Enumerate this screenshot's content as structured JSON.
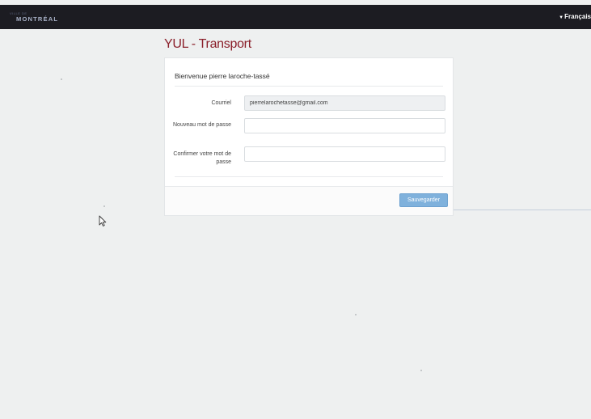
{
  "header": {
    "logo_small": "VILLE DE",
    "logo_text": "MONTRÉAL",
    "language_toggle": "Français"
  },
  "app": {
    "title": "YUL - Transport"
  },
  "form": {
    "welcome": "Bienvenue pierre laroche-tassé",
    "email": {
      "label": "Courriel",
      "value": "pierrelarochetasse@gmail.com"
    },
    "new_password": {
      "label": "Nouveau mot de passe",
      "value": ""
    },
    "confirm_password": {
      "label": "Confirmer votre mot de passe",
      "value": ""
    },
    "save_label": "Sauvegarder"
  },
  "icons": {
    "cursor": "mouse-pointer-icon",
    "language_chevron": "chevron-down-icon"
  },
  "colors": {
    "topbar": "#1c1c22",
    "title": "#8a1f2a",
    "button": "#7fb1dc"
  }
}
